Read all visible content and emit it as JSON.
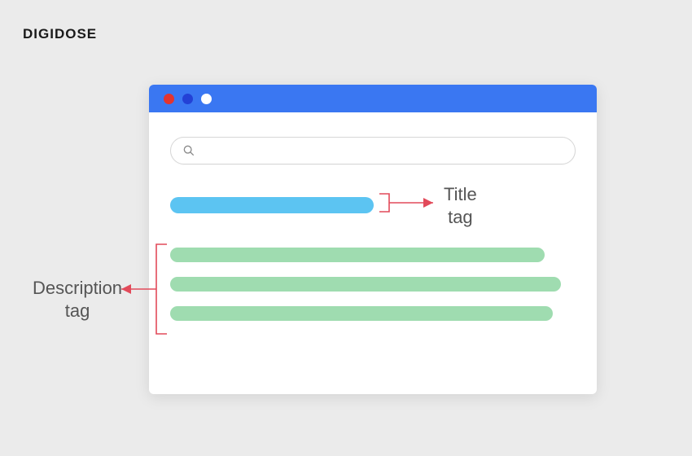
{
  "brand": {
    "logo_text": "DIGIDOSE"
  },
  "annotations": {
    "title_label": "Title\ntag",
    "description_label": "Description\ntag"
  },
  "colors": {
    "title_bar": "#3a77f2",
    "title_line": "#5cc4f2",
    "desc_line": "#9fdcb0",
    "annotation_stroke": "#e24a5a",
    "dot_red": "#e3342f",
    "dot_blue": "#2341d6",
    "dot_white": "#ffffff"
  },
  "search": {
    "placeholder": ""
  }
}
